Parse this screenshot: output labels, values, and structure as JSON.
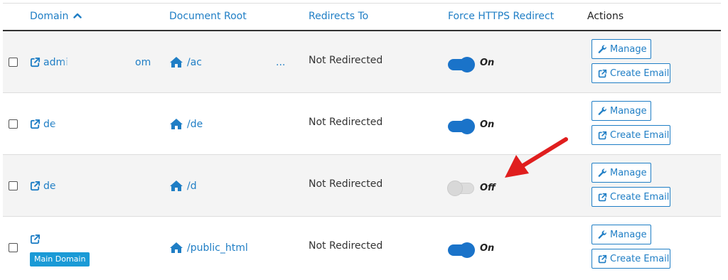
{
  "header": {
    "domain": "Domain",
    "document_root": "Document Root",
    "redirects_to": "Redirects To",
    "force_https": "Force HTTPS Redirect",
    "actions": "Actions"
  },
  "rows": [
    {
      "domain": "admi",
      "domain_tail": "om",
      "document_root": "/ac",
      "document_root_tail": "...",
      "redirects_to": "Not Redirected",
      "https_label": "On",
      "https_enabled": true,
      "manage_label": "Manage",
      "email_label": "Create Email"
    },
    {
      "domain": "de",
      "domain_tail": "",
      "document_root": "/de",
      "document_root_tail": "",
      "redirects_to": "Not Redirected",
      "https_label": "On",
      "https_enabled": true,
      "manage_label": "Manage",
      "email_label": "Create Email"
    },
    {
      "domain": "de",
      "domain_tail": "",
      "document_root": "/d",
      "document_root_tail": "",
      "redirects_to": "Not Redirected",
      "https_label": "Off",
      "https_enabled": false,
      "manage_label": "Manage",
      "email_label": "Create Email"
    },
    {
      "domain": "",
      "domain_tail": "",
      "badge": "Main Domain",
      "document_root": "/public_html",
      "document_root_tail": "",
      "redirects_to": "Not Redirected",
      "https_label": "On",
      "https_enabled": true,
      "manage_label": "Manage",
      "email_label": "Create Email"
    }
  ],
  "colors": {
    "link": "#1f7ec5",
    "toggle_on": "#1a73c9",
    "toggle_off": "#dcdcdc",
    "badge": "#1a9ad6",
    "annotation_arrow": "#e01e1e"
  },
  "icons": {
    "sort": "chevron-up-icon",
    "domain_link": "external-link-icon",
    "document_root": "home-icon",
    "manage": "wrench-icon",
    "create_email": "external-link-icon",
    "annotation": "red-arrow-icon"
  }
}
